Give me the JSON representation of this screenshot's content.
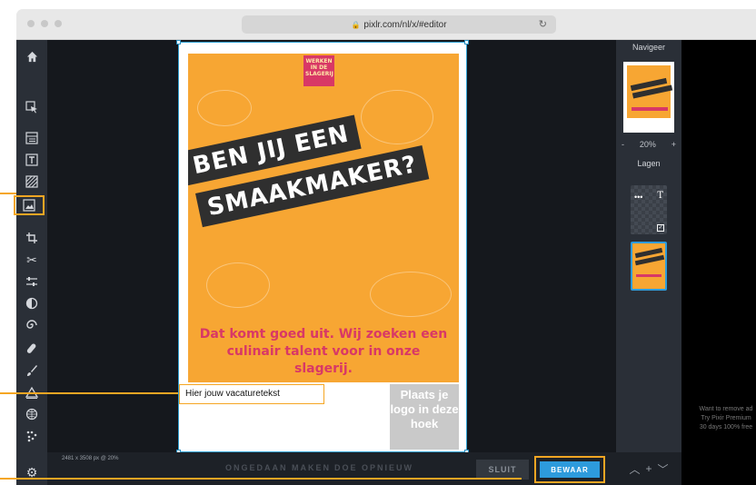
{
  "browser": {
    "url": "pixlr.com/nl/x/#editor"
  },
  "toolbar": {
    "icons": [
      "home-icon",
      "arrange-icon",
      "layout-icon",
      "text-icon",
      "pattern-icon",
      "image-icon",
      "crop-icon",
      "cutout-icon",
      "adjust-icon",
      "filter-icon",
      "liquify-icon",
      "heal-icon",
      "brush-icon",
      "draw-icon",
      "shape-icon",
      "grid-icon",
      "settings-icon"
    ]
  },
  "canvas": {
    "dimensions": "2481 x 3508 px @ 20%",
    "brand": "WERKEN IN DE SLAGERIJ",
    "headline1": "BEN JIJ EEN",
    "headline2": "SMAAKMAKER?",
    "tagline": "Dat komt goed uit. Wij zoeken een culinair talent voor in onze slagerij.",
    "job_text": "Hier jouw vacaturetekst",
    "logo_placeholder": "Plaats je logo in deze hoek"
  },
  "bottombar": {
    "undo_label": "ONGEDAAN MAKEN",
    "redo_label": "DOE OPNIEUW",
    "close_label": "SLUIT",
    "save_label": "BEWAAR"
  },
  "rightpanel": {
    "navigator_title": "Navigeer",
    "zoom_minus": "-",
    "zoom_value": "20%",
    "zoom_plus": "+",
    "layers_title": "Lagen"
  },
  "promo": {
    "line1": "Want to remove ad",
    "line2": "Try Pixir Premium",
    "line3": "30 days 100% free"
  },
  "colors": {
    "accent": "#f5a623",
    "poster_orange": "#f7a633",
    "poster_pink": "#d83866",
    "save_blue": "#2d9bdc"
  }
}
